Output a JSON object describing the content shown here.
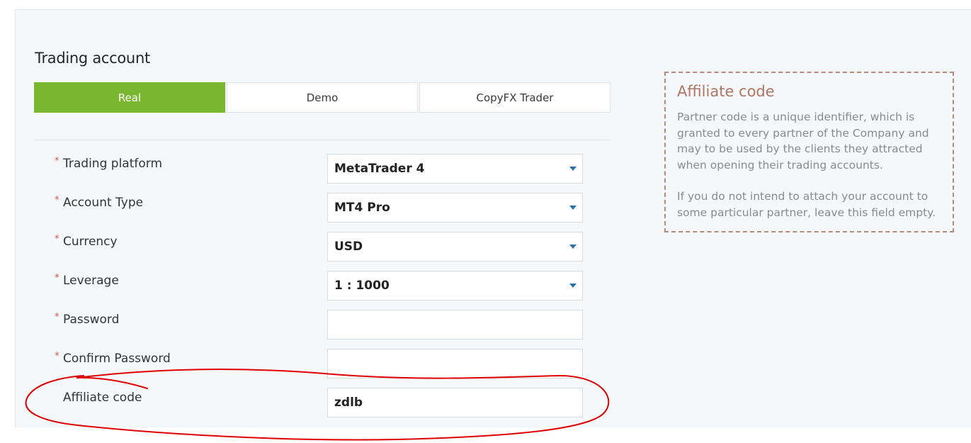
{
  "form": {
    "title": "Trading account",
    "tabs": [
      {
        "label": "Real",
        "active": true
      },
      {
        "label": "Demo",
        "active": false
      },
      {
        "label": "CopyFX Trader",
        "active": false
      }
    ],
    "required_marker": "*",
    "fields": [
      {
        "label": "Trading platform",
        "type": "select",
        "value": "MetaTrader 4",
        "required": true
      },
      {
        "label": "Account Type",
        "type": "select",
        "value": "MT4 Pro",
        "required": true
      },
      {
        "label": "Currency",
        "type": "select",
        "value": "USD",
        "required": true
      },
      {
        "label": "Leverage",
        "type": "select",
        "value": "1 : 1000",
        "required": true
      },
      {
        "label": "Password",
        "type": "password",
        "value": "",
        "required": true
      },
      {
        "label": "Confirm Password",
        "type": "password",
        "value": "",
        "required": true
      },
      {
        "label": "Affiliate code",
        "type": "text",
        "value": "zdlb",
        "required": false
      }
    ]
  },
  "info_box": {
    "title": "Affiliate code",
    "paragraph1": "Partner code is a unique identifier, which is granted to every partner of the Company and may to be used by the clients they attracted when opening their trading accounts.",
    "paragraph2": "If you do not intend to attach your account to some particular partner, leave this field empty."
  },
  "colors": {
    "accent_green": "#7ab730",
    "required_red": "#d9534f",
    "caret_blue": "#2a6fb0",
    "annotation_red": "#e00000",
    "info_title": "#b07563"
  },
  "icons": {
    "select_caret": "chevron-down-icon"
  }
}
